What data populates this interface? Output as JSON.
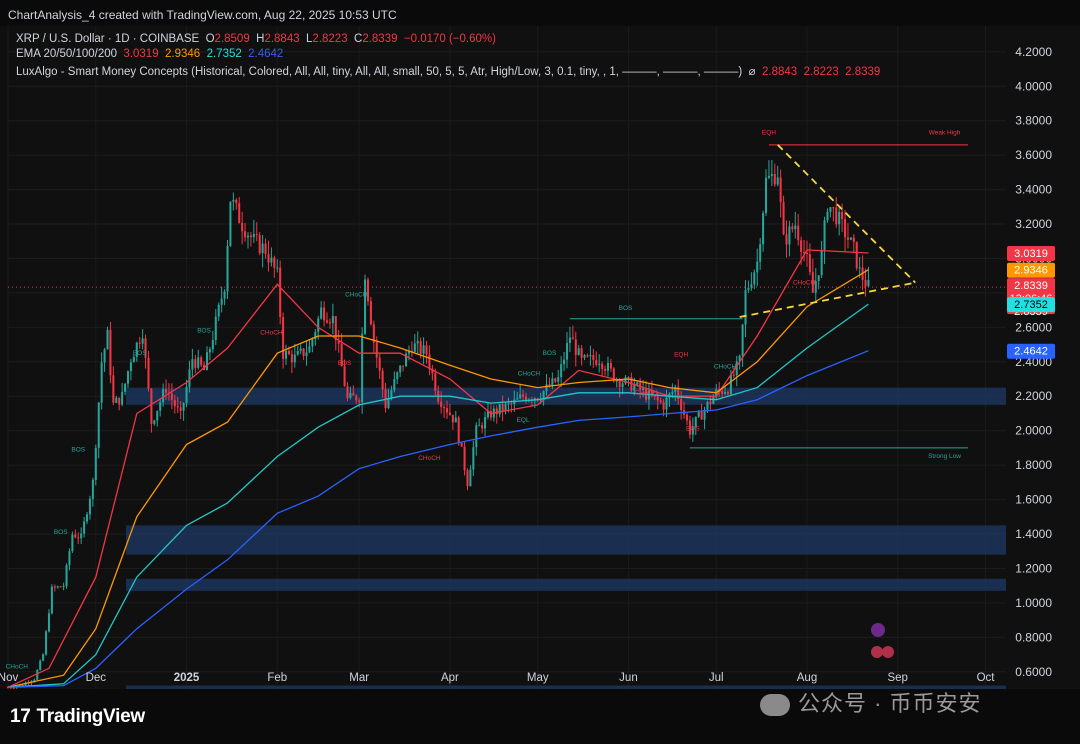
{
  "header": {
    "created_by": "ChartAnalysis_4 created with TradingView.com, Aug 22, 2025 10:53 UTC"
  },
  "legend": {
    "symbol": "XRP / U.S. Dollar · 1D · COINBASE",
    "open_label": "O",
    "open": "2.8509",
    "high_label": "H",
    "high": "2.8843",
    "low_label": "L",
    "low": "2.8223",
    "close_label": "C",
    "close": "2.8339",
    "change": "−0.0170 (−0.60%)",
    "ema_label": "EMA 20/50/100/200",
    "ema20": "3.0319",
    "ema50": "2.9346",
    "ema100": "2.7352",
    "ema200": "2.4642",
    "indicator": "LuxAlgo - Smart Money Concepts (Historical, Colored, All, All, tiny, All, All, small, 50, 5, 5, Atr, High/Low, 3, 0.1, tiny, , 1, ———, ———, ———)",
    "indicator_values": [
      "2.8843",
      "2.8223",
      "2.8339"
    ]
  },
  "colors": {
    "background": "#101010",
    "up": "#26a69a",
    "down": "#f23645",
    "ema20": "#f23645",
    "ema50": "#ff9800",
    "ema100": "#22c7c7",
    "ema200": "#2962ff",
    "triangle": "#f5d742",
    "zone": "#1e3a66"
  },
  "footer": {
    "logo": "TradingView",
    "watermark": "公众号 · 币币安安"
  },
  "chart_data": {
    "type": "candlestick",
    "title": "XRP / U.S. Dollar · 1D · COINBASE",
    "ylim": [
      0.5,
      4.35
    ],
    "y_ticks": [
      "0.6000",
      "0.8000",
      "1.0000",
      "1.2000",
      "1.4000",
      "1.6000",
      "1.8000",
      "2.0000",
      "2.2000",
      "2.4000",
      "2.6000",
      "2.8000",
      "3.0000",
      "3.2000",
      "3.4000",
      "3.6000",
      "3.8000",
      "4.0000",
      "4.2000"
    ],
    "x_ticks": [
      {
        "label": "Nov",
        "date": "2024-11-01"
      },
      {
        "label": "Dec",
        "date": "2024-12-01"
      },
      {
        "label": "2025",
        "date": "2025-01-01",
        "bold": true
      },
      {
        "label": "Feb",
        "date": "2025-02-01"
      },
      {
        "label": "Mar",
        "date": "2025-03-01"
      },
      {
        "label": "Apr",
        "date": "2025-04-01"
      },
      {
        "label": "May",
        "date": "2025-05-01"
      },
      {
        "label": "Jun",
        "date": "2025-06-01"
      },
      {
        "label": "Jul",
        "date": "2025-07-01"
      },
      {
        "label": "Aug",
        "date": "2025-08-01"
      },
      {
        "label": "Sep",
        "date": "2025-09-01"
      },
      {
        "label": "Oct",
        "date": "2025-10-01"
      }
    ],
    "x_range": [
      "2024-11-01",
      "2025-10-08"
    ],
    "price_path": [
      [
        "2024-11-01",
        0.51
      ],
      [
        "2024-11-05",
        0.52
      ],
      [
        "2024-11-10",
        0.56
      ],
      [
        "2024-11-13",
        0.7
      ],
      [
        "2024-11-16",
        1.08
      ],
      [
        "2024-11-20",
        1.1
      ],
      [
        "2024-11-23",
        1.4
      ],
      [
        "2024-11-26",
        1.38
      ],
      [
        "2024-11-30",
        1.7
      ],
      [
        "2024-12-03",
        2.4
      ],
      [
        "2024-12-05",
        2.55
      ],
      [
        "2024-12-07",
        2.15
      ],
      [
        "2024-12-10",
        2.2
      ],
      [
        "2024-12-13",
        2.42
      ],
      [
        "2024-12-17",
        2.58
      ],
      [
        "2024-12-20",
        2.05
      ],
      [
        "2024-12-25",
        2.25
      ],
      [
        "2024-12-30",
        2.08
      ],
      [
        "2025-01-03",
        2.42
      ],
      [
        "2025-01-07",
        2.35
      ],
      [
        "2025-01-10",
        2.55
      ],
      [
        "2025-01-14",
        2.85
      ],
      [
        "2025-01-16",
        3.35
      ],
      [
        "2025-01-20",
        3.2
      ],
      [
        "2025-01-24",
        3.1
      ],
      [
        "2025-01-28",
        3.05
      ],
      [
        "2025-02-01",
        2.9
      ],
      [
        "2025-02-03",
        2.45
      ],
      [
        "2025-02-07",
        2.42
      ],
      [
        "2025-02-12",
        2.48
      ],
      [
        "2025-02-16",
        2.7
      ],
      [
        "2025-02-20",
        2.65
      ],
      [
        "2025-02-25",
        2.18
      ],
      [
        "2025-03-01",
        2.2
      ],
      [
        "2025-03-03",
        2.92
      ],
      [
        "2025-03-06",
        2.52
      ],
      [
        "2025-03-10",
        2.15
      ],
      [
        "2025-03-14",
        2.32
      ],
      [
        "2025-03-19",
        2.5
      ],
      [
        "2025-03-24",
        2.45
      ],
      [
        "2025-03-28",
        2.2
      ],
      [
        "2025-04-03",
        2.05
      ],
      [
        "2025-04-07",
        1.7
      ],
      [
        "2025-04-10",
        2.0
      ],
      [
        "2025-04-15",
        2.1
      ],
      [
        "2025-04-22",
        2.15
      ],
      [
        "2025-04-26",
        2.2
      ],
      [
        "2025-05-01",
        2.2
      ],
      [
        "2025-05-08",
        2.3
      ],
      [
        "2025-05-12",
        2.55
      ],
      [
        "2025-05-16",
        2.4
      ],
      [
        "2025-05-22",
        2.42
      ],
      [
        "2025-05-28",
        2.3
      ],
      [
        "2025-06-03",
        2.26
      ],
      [
        "2025-06-08",
        2.2
      ],
      [
        "2025-06-13",
        2.15
      ],
      [
        "2025-06-17",
        2.25
      ],
      [
        "2025-06-22",
        2.0
      ],
      [
        "2025-06-26",
        2.1
      ],
      [
        "2025-07-01",
        2.22
      ],
      [
        "2025-07-05",
        2.25
      ],
      [
        "2025-07-09",
        2.4
      ],
      [
        "2025-07-11",
        2.8
      ],
      [
        "2025-07-15",
        2.98
      ],
      [
        "2025-07-18",
        3.45
      ],
      [
        "2025-07-22",
        3.5
      ],
      [
        "2025-07-24",
        3.1
      ],
      [
        "2025-07-28",
        3.2
      ],
      [
        "2025-08-01",
        2.98
      ],
      [
        "2025-08-03",
        2.8
      ],
      [
        "2025-08-06",
        3.02
      ],
      [
        "2025-08-08",
        3.32
      ],
      [
        "2025-08-11",
        3.25
      ],
      [
        "2025-08-14",
        3.15
      ],
      [
        "2025-08-17",
        3.05
      ],
      [
        "2025-08-19",
        2.92
      ],
      [
        "2025-08-22",
        2.8339
      ]
    ],
    "series": [
      {
        "name": "EMA 20",
        "values": [
          [
            "2024-11-01",
            0.51
          ],
          [
            "2024-11-15",
            0.62
          ],
          [
            "2024-12-01",
            1.15
          ],
          [
            "2024-12-15",
            2.1
          ],
          [
            "2025-01-01",
            2.28
          ],
          [
            "2025-01-15",
            2.48
          ],
          [
            "2025-02-01",
            2.85
          ],
          [
            "2025-02-15",
            2.6
          ],
          [
            "2025-03-01",
            2.45
          ],
          [
            "2025-03-15",
            2.45
          ],
          [
            "2025-04-01",
            2.3
          ],
          [
            "2025-04-15",
            2.1
          ],
          [
            "2025-05-01",
            2.15
          ],
          [
            "2025-05-15",
            2.35
          ],
          [
            "2025-06-01",
            2.28
          ],
          [
            "2025-06-15",
            2.2
          ],
          [
            "2025-07-01",
            2.2
          ],
          [
            "2025-07-15",
            2.55
          ],
          [
            "2025-08-01",
            3.05
          ],
          [
            "2025-08-22",
            3.0319
          ]
        ]
      },
      {
        "name": "EMA 50",
        "values": [
          [
            "2024-11-01",
            0.51
          ],
          [
            "2024-11-20",
            0.58
          ],
          [
            "2024-12-01",
            0.85
          ],
          [
            "2024-12-15",
            1.5
          ],
          [
            "2025-01-01",
            1.92
          ],
          [
            "2025-01-15",
            2.05
          ],
          [
            "2025-02-01",
            2.45
          ],
          [
            "2025-02-15",
            2.55
          ],
          [
            "2025-03-01",
            2.55
          ],
          [
            "2025-03-15",
            2.48
          ],
          [
            "2025-04-01",
            2.38
          ],
          [
            "2025-04-15",
            2.3
          ],
          [
            "2025-05-01",
            2.25
          ],
          [
            "2025-05-15",
            2.28
          ],
          [
            "2025-06-01",
            2.3
          ],
          [
            "2025-06-15",
            2.25
          ],
          [
            "2025-07-01",
            2.22
          ],
          [
            "2025-07-15",
            2.4
          ],
          [
            "2025-08-01",
            2.72
          ],
          [
            "2025-08-22",
            2.9346
          ]
        ]
      },
      {
        "name": "EMA 100",
        "values": [
          [
            "2024-11-01",
            0.51
          ],
          [
            "2024-11-20",
            0.53
          ],
          [
            "2024-12-01",
            0.7
          ],
          [
            "2024-12-15",
            1.15
          ],
          [
            "2025-01-01",
            1.45
          ],
          [
            "2025-01-15",
            1.58
          ],
          [
            "2025-02-01",
            1.85
          ],
          [
            "2025-02-15",
            2.02
          ],
          [
            "2025-03-01",
            2.15
          ],
          [
            "2025-03-15",
            2.2
          ],
          [
            "2025-04-01",
            2.2
          ],
          [
            "2025-04-15",
            2.16
          ],
          [
            "2025-05-01",
            2.18
          ],
          [
            "2025-05-15",
            2.22
          ],
          [
            "2025-06-01",
            2.22
          ],
          [
            "2025-06-15",
            2.2
          ],
          [
            "2025-07-01",
            2.18
          ],
          [
            "2025-07-15",
            2.25
          ],
          [
            "2025-08-01",
            2.48
          ],
          [
            "2025-08-22",
            2.7352
          ]
        ]
      },
      {
        "name": "EMA 200",
        "values": [
          [
            "2024-11-01",
            0.51
          ],
          [
            "2024-11-20",
            0.52
          ],
          [
            "2024-12-01",
            0.62
          ],
          [
            "2024-12-15",
            0.85
          ],
          [
            "2025-01-01",
            1.08
          ],
          [
            "2025-01-15",
            1.25
          ],
          [
            "2025-02-01",
            1.52
          ],
          [
            "2025-02-15",
            1.62
          ],
          [
            "2025-03-01",
            1.78
          ],
          [
            "2025-03-15",
            1.85
          ],
          [
            "2025-04-01",
            1.92
          ],
          [
            "2025-04-15",
            1.97
          ],
          [
            "2025-05-01",
            2.02
          ],
          [
            "2025-05-15",
            2.06
          ],
          [
            "2025-06-01",
            2.08
          ],
          [
            "2025-06-15",
            2.1
          ],
          [
            "2025-07-01",
            2.12
          ],
          [
            "2025-07-15",
            2.18
          ],
          [
            "2025-08-01",
            2.32
          ],
          [
            "2025-08-22",
            2.4642
          ]
        ]
      }
    ],
    "price_labels": [
      {
        "value": 3.0319,
        "text": "3.0319",
        "bg": "#f23645",
        "color": "#ffffff"
      },
      {
        "value": 2.9346,
        "text": "2.9346",
        "bg": "#ff9800",
        "color": "#ffffff"
      },
      {
        "value": 2.8339,
        "text": "2.8339",
        "bg": "#f23645",
        "color": "#ffffff",
        "sub": "13:06:46"
      },
      {
        "value": 2.7352,
        "text": "2.7352",
        "bg": "#22e0e0",
        "color": "#000000"
      },
      {
        "value": 2.4642,
        "text": "2.4642",
        "bg": "#2962ff",
        "color": "#ffffff"
      }
    ],
    "zones": [
      [
        2.15,
        2.25
      ],
      [
        1.28,
        1.45
      ],
      [
        1.07,
        1.14
      ],
      [
        0.5,
        0.52
      ]
    ],
    "triangle": {
      "upper": [
        [
          "2025-07-22",
          3.66
        ],
        [
          "2025-09-07",
          2.86
        ]
      ],
      "lower": [
        [
          "2025-07-09",
          2.66
        ],
        [
          "2025-09-07",
          2.86
        ]
      ]
    },
    "levels": [
      {
        "label": "Weak High",
        "value": 3.66,
        "from": "2025-07-19",
        "to": "2025-09-25",
        "color": "#f23645"
      },
      {
        "label": "Strong Low",
        "value": 1.9,
        "from": "2025-06-22",
        "to": "2025-09-25",
        "color": "#26a69a"
      },
      {
        "label": "BOS",
        "value": 2.65,
        "from": "2025-05-12",
        "to": "2025-07-10",
        "color": "#26a69a"
      }
    ],
    "annotations": [
      {
        "text": "EQH",
        "date": "2025-07-19",
        "value": 3.72,
        "color": "#f23645"
      },
      {
        "text": "Weak High",
        "date": "2025-09-17",
        "value": 3.72,
        "color": "#f23645"
      },
      {
        "text": "Strong Low",
        "date": "2025-09-17",
        "value": 1.84,
        "color": "#26a69a"
      },
      {
        "text": "BOS",
        "date": "2025-05-31",
        "value": 2.7,
        "color": "#26a69a"
      },
      {
        "text": "CHoCH",
        "date": "2025-07-31",
        "value": 2.85,
        "color": "#f23645"
      },
      {
        "text": "EQH",
        "date": "2025-06-19",
        "value": 2.43,
        "color": "#f23645"
      },
      {
        "text": "CHoCH",
        "date": "2025-06-07",
        "value": 2.21,
        "color": "#f23645"
      },
      {
        "text": "BOS",
        "date": "2025-06-23",
        "value": 2.0,
        "color": "#f23645"
      },
      {
        "text": "CHoCH",
        "date": "2025-07-04",
        "value": 2.36,
        "color": "#26a69a"
      },
      {
        "text": "CHoCH",
        "date": "2025-04-28",
        "value": 2.32,
        "color": "#26a69a"
      },
      {
        "text": "BOS",
        "date": "2025-05-05",
        "value": 2.44,
        "color": "#26a69a"
      },
      {
        "text": "EQL",
        "date": "2025-04-26",
        "value": 2.05,
        "color": "#26a69a"
      },
      {
        "text": "CHoCH",
        "date": "2025-03-25",
        "value": 1.83,
        "color": "#f23645"
      },
      {
        "text": "CHoCH",
        "date": "2025-02-28",
        "value": 2.78,
        "color": "#26a69a"
      },
      {
        "text": "BOS",
        "date": "2025-02-24",
        "value": 2.38,
        "color": "#f23645"
      },
      {
        "text": "CHoCH",
        "date": "2025-01-30",
        "value": 2.56,
        "color": "#f23645"
      },
      {
        "text": "BOS",
        "date": "2024-12-16",
        "value": 2.44,
        "color": "#26a69a"
      },
      {
        "text": "BOS",
        "date": "2025-01-07",
        "value": 2.57,
        "color": "#26a69a"
      },
      {
        "text": "BOS",
        "date": "2024-11-25",
        "value": 1.88,
        "color": "#26a69a"
      },
      {
        "text": "BOS",
        "date": "2024-11-19",
        "value": 1.4,
        "color": "#26a69a"
      },
      {
        "text": "CHoCH",
        "date": "2024-11-04",
        "value": 0.62,
        "color": "#26a69a"
      }
    ]
  }
}
